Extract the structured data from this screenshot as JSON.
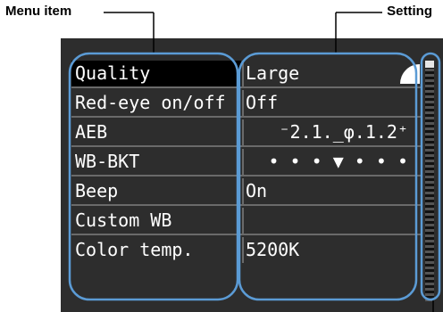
{
  "callouts": {
    "menu_item": "Menu item",
    "setting": "Setting"
  },
  "menu": {
    "rows": [
      {
        "label": "Quality",
        "value": "Large",
        "selected": true,
        "value_icon": "quality-large-icon"
      },
      {
        "label": "Red-eye on/off",
        "value": "Off"
      },
      {
        "label": "AEB",
        "value": "⁻2.1.̲φ.1.2⁺"
      },
      {
        "label": "WB-BKT",
        "value": "• • • ▼ • • •"
      },
      {
        "label": "Beep",
        "value": "On"
      },
      {
        "label": "Custom WB",
        "value": ""
      },
      {
        "label": "Color temp.",
        "value": "5200K"
      }
    ]
  },
  "colors": {
    "screen_bg": "#2d2d2d",
    "selected_bg": "#000000",
    "text": "#ffffff",
    "callout_outline": "#5b9bd5"
  }
}
